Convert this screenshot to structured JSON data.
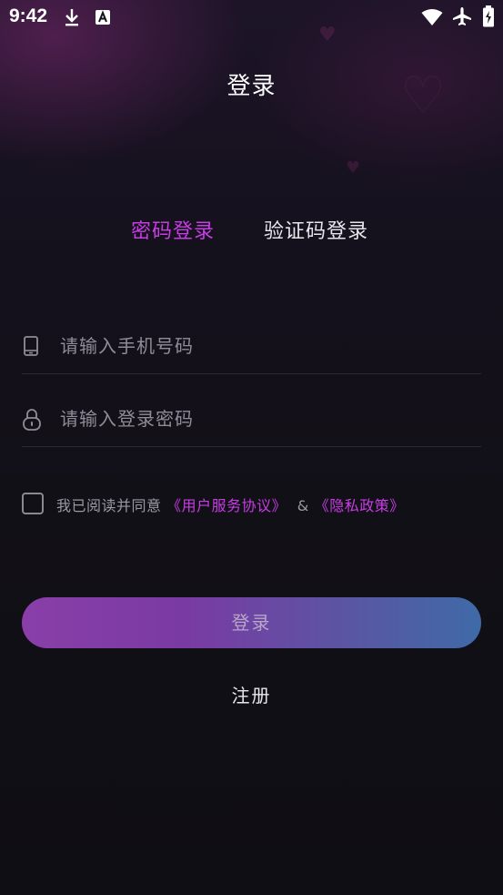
{
  "status_bar": {
    "time": "9:42",
    "icons": [
      "download-icon",
      "a-badge-icon",
      "wifi-icon",
      "airplane-icon",
      "battery-icon"
    ]
  },
  "header": {
    "title": "登录"
  },
  "tabs": [
    {
      "label": "密码登录",
      "active": true
    },
    {
      "label": "验证码登录",
      "active": false
    }
  ],
  "form": {
    "phone": {
      "placeholder": "请输入手机号码",
      "value": "",
      "icon": "phone-icon"
    },
    "password": {
      "placeholder": "请输入登录密码",
      "value": "",
      "icon": "lock-icon"
    }
  },
  "agreement": {
    "checked": false,
    "text": "我已阅读并同意",
    "terms_link": "《用户服务协议》",
    "amp": "&",
    "privacy_link": "《隐私政策》"
  },
  "actions": {
    "login_label": "登录",
    "register_label": "注册"
  },
  "colors": {
    "accent": "#c63de3",
    "button_gradient_start": "#8a3fa8",
    "button_gradient_end": "#3f6aa7",
    "background": "#121017"
  }
}
